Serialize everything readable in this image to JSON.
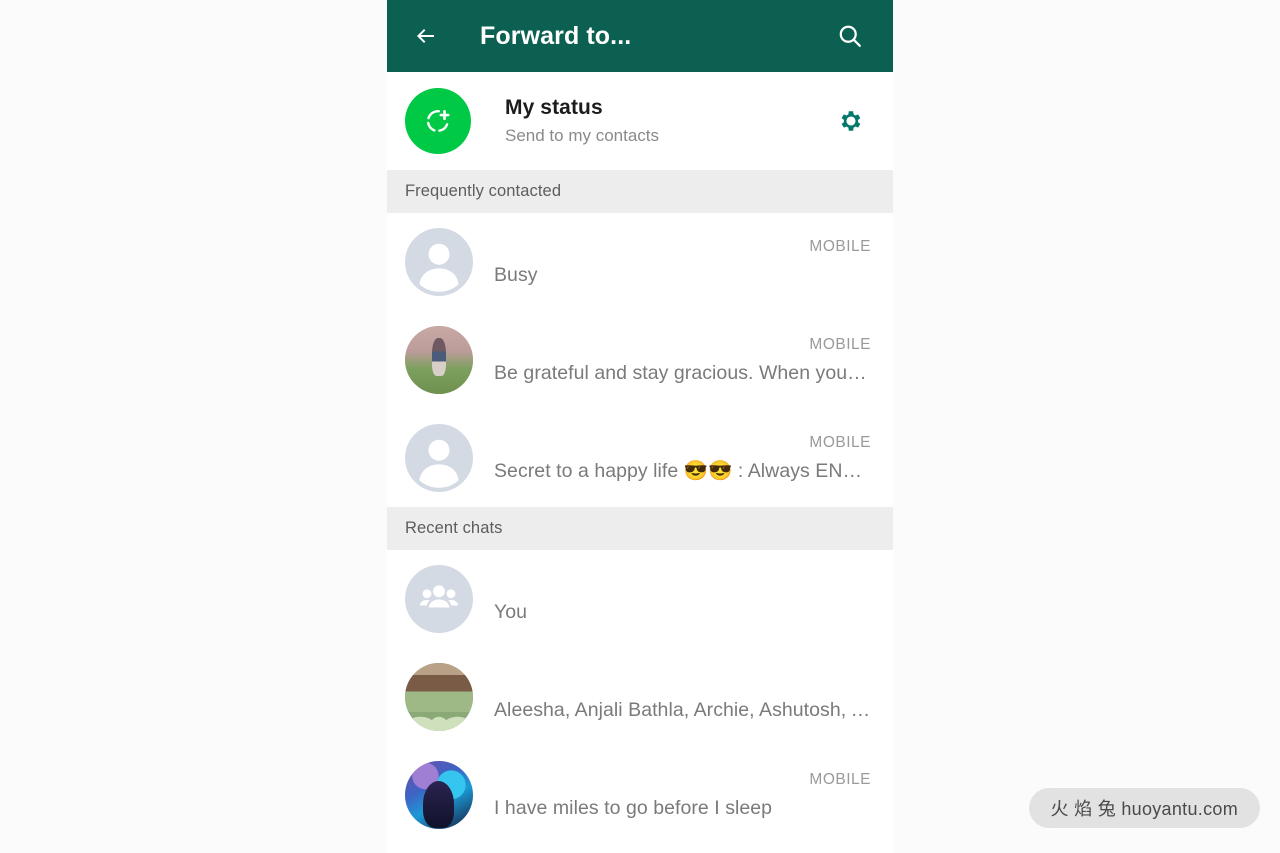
{
  "appbar": {
    "back_icon": "arrow-left-icon",
    "title": "Forward to...",
    "search_icon": "search-icon",
    "background_color": "#0b6051"
  },
  "my_status": {
    "avatar_icon": "status-add-icon",
    "avatar_color": "#00c945",
    "title": "My status",
    "subtitle": "Send to my contacts",
    "settings_icon": "gear-icon",
    "settings_icon_color": "#00796b"
  },
  "sections": [
    {
      "header": "Frequently contacted",
      "rows": [
        {
          "avatar_type": "placeholder",
          "avatar_icon": "person-icon",
          "name": "",
          "subtitle": "Busy",
          "badge": "MOBILE"
        },
        {
          "avatar_type": "photo",
          "avatar_art": "art-girl",
          "name": "",
          "subtitle": "Be grateful and stay gracious. When you tru…",
          "badge": "MOBILE"
        },
        {
          "avatar_type": "placeholder",
          "avatar_icon": "person-icon",
          "name": "",
          "subtitle": "Secret to a happy life 😎😎 :  Always ENJO…",
          "badge": "MOBILE"
        }
      ]
    },
    {
      "header": "Recent chats",
      "rows": [
        {
          "avatar_type": "group",
          "avatar_icon": "group-people-icon",
          "name": "",
          "subtitle": "You",
          "badge": ""
        },
        {
          "avatar_type": "photo",
          "avatar_art": "art-plants",
          "name": "",
          "subtitle": "Aleesha, Anjali Bathla, Archie, Ashutosh, As…",
          "badge": ""
        },
        {
          "avatar_type": "photo",
          "avatar_art": "art-abstract",
          "name": "",
          "subtitle": "I have miles to go before I sleep",
          "badge": "MOBILE"
        }
      ]
    }
  ],
  "watermark": {
    "text": "火 焰 兔 huoyantu.com"
  }
}
